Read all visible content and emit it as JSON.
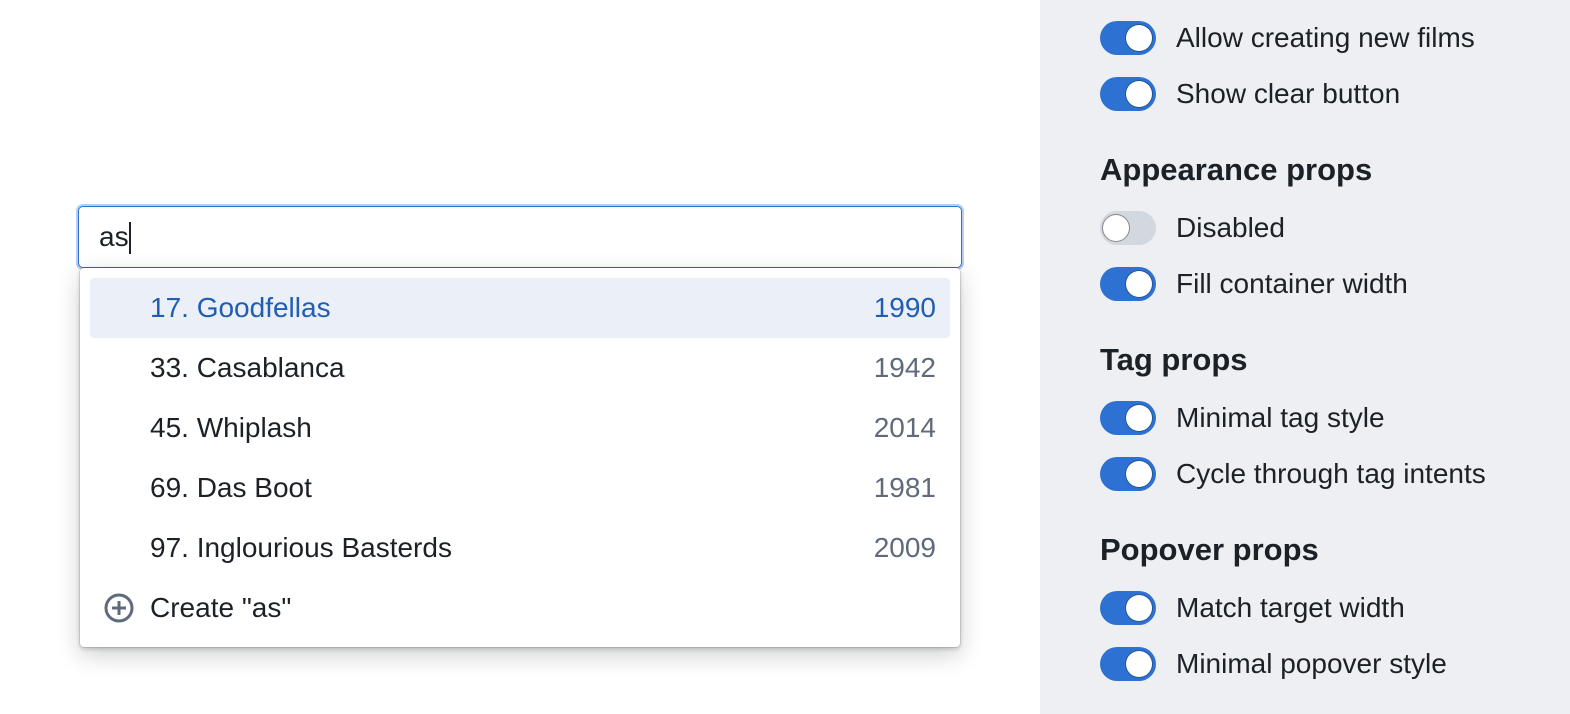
{
  "search": {
    "value": "as"
  },
  "results": [
    {
      "label": "17. Goodfellas",
      "year": "1990",
      "active": true
    },
    {
      "label": "33. Casablanca",
      "year": "1942",
      "active": false
    },
    {
      "label": "45. Whiplash",
      "year": "2014",
      "active": false
    },
    {
      "label": "69. Das Boot",
      "year": "1981",
      "active": false
    },
    {
      "label": "97. Inglourious Basterds",
      "year": "2009",
      "active": false
    }
  ],
  "create_item": {
    "label": "Create \"as\"",
    "icon": "add-circle-icon"
  },
  "sidebar": {
    "toggles_top": [
      {
        "label": "Allow creating new films",
        "on": true
      },
      {
        "label": "Show clear button",
        "on": true
      }
    ],
    "sections": [
      {
        "title": "Appearance props",
        "toggles": [
          {
            "label": "Disabled",
            "on": false
          },
          {
            "label": "Fill container width",
            "on": true
          }
        ]
      },
      {
        "title": "Tag props",
        "toggles": [
          {
            "label": "Minimal tag style",
            "on": true
          },
          {
            "label": "Cycle through tag intents",
            "on": true
          }
        ]
      },
      {
        "title": "Popover props",
        "toggles": [
          {
            "label": "Match target width",
            "on": true
          },
          {
            "label": "Minimal popover style",
            "on": true
          }
        ]
      }
    ]
  },
  "colors": {
    "accent": "#2d72d2",
    "active_bg": "#eaeff8",
    "active_text": "#215db0",
    "sidebar_bg": "#edeff2",
    "muted_text": "#5f6b7c"
  }
}
